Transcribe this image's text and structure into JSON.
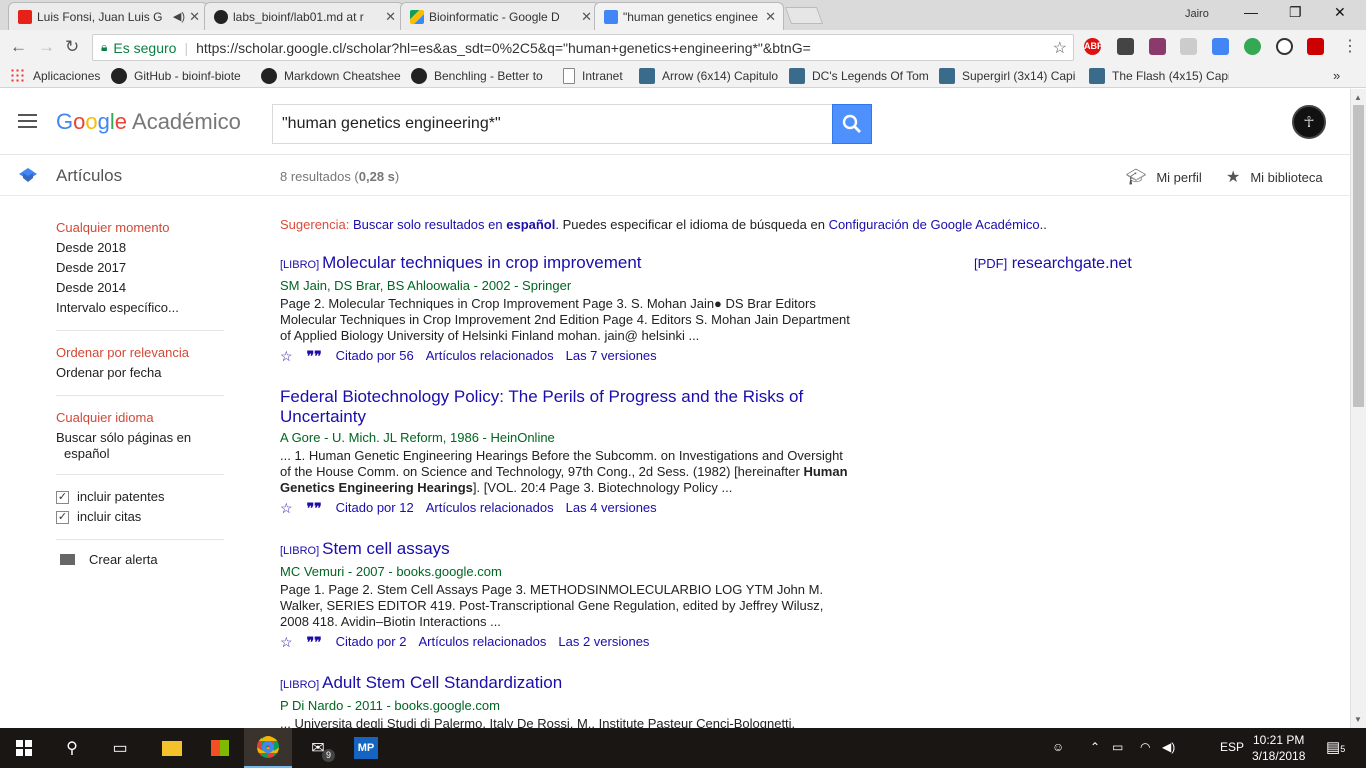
{
  "tabs": [
    {
      "title": "Luis Fonsi, Juan Luis G",
      "favicon": "youtube-icon",
      "color": "#e62117"
    },
    {
      "title": "labs_bioinf/lab01.md at r",
      "favicon": "github-icon",
      "color": "#222222"
    },
    {
      "title": "Bioinformatic - Google D",
      "favicon": "google-drive-icon",
      "color": "#fbbc05"
    },
    {
      "title": "\"human genetics enginee",
      "favicon": "google-scholar-icon",
      "color": "#4285f4"
    }
  ],
  "profile_name": "Jairo",
  "omnibox": {
    "secure_label": "Es seguro",
    "url": "https://scholar.google.cl/scholar?hl=es&as_sdt=0%2C5&q=\"human+genetics+engineering*\"&btnG="
  },
  "bookmarks": [
    {
      "label": "Aplicaciones",
      "icon": "apps-grid-icon"
    },
    {
      "label": "GitHub - bioinf-biote",
      "icon": "github-icon"
    },
    {
      "label": "Markdown Cheatshee",
      "icon": "github-icon"
    },
    {
      "label": "Benchling - Better to",
      "icon": "benchling-icon"
    },
    {
      "label": "Intranet",
      "icon": "page-icon"
    },
    {
      "label": "Arrow (6x14) Capitulo",
      "icon": "tv-icon"
    },
    {
      "label": "DC's Legends Of Tom",
      "icon": "tv-icon"
    },
    {
      "label": "Supergirl (3x14) Capi",
      "icon": "tv-icon"
    },
    {
      "label": "The Flash (4x15) Capi",
      "icon": "tv-icon"
    }
  ],
  "header": {
    "logo_google": "Google",
    "logo_suffix": "Académico",
    "search_value": "\"human genetics engineering*\"",
    "section": "Artículos",
    "count_prefix": "8 resultados (",
    "count_time": "0,28 s",
    "count_suffix": ")",
    "profile": "Mi perfil",
    "library": "Mi biblioteca"
  },
  "sidebar": {
    "time": [
      "Cualquier momento",
      "Desde 2018",
      "Desde 2017",
      "Desde 2014",
      "Intervalo específico..."
    ],
    "sort": [
      "Ordenar por relevancia",
      "Ordenar por fecha"
    ],
    "lang": [
      "Cualquier idioma",
      "Buscar sólo páginas en",
      "español"
    ],
    "checks": [
      "incluir patentes",
      "incluir citas"
    ],
    "alert": "Crear alerta"
  },
  "suggestion": {
    "label": "Sugerencia:",
    "link1": "Buscar solo resultados en",
    "link1_bold": "español",
    "mid": ". Puedes especificar el idioma de búsqueda en",
    "link2": "Configuración de Google Académico",
    "end": ".."
  },
  "pdf": {
    "tag": "[PDF]",
    "source": "researchgate.net"
  },
  "results": [
    {
      "tag": "[LIBRO]",
      "title": "Molecular techniques in crop improvement",
      "meta": "SM Jain, DS Brar, BS Ahloowalia - 2002 - Springer",
      "snippet": "Page 2. Molecular Techniques in Crop Improvement Page 3. S. Mohan Jain● DS Brar Editors Molecular Techniques in Crop Improvement 2nd Edition Page 4. Editors S. Mohan Jain Department of Applied Biology University of Helsinki Finland mohan. jain@ helsinki ...",
      "cited": "Citado por 56",
      "related": "Artículos relacionados",
      "versions": "Las 7 versiones"
    },
    {
      "tag": "",
      "title": "Federal Biotechnology Policy: The Perils of Progress and the Risks of Uncertainty",
      "meta": "A Gore - U. Mich. JL Reform, 1986 - HeinOnline",
      "snippet_pre": "... 1. Human Genetic Engineering Hearings Before the Subcomm. on Investigations and Oversight of the House Comm. on Science and Technology, 97th Cong., 2d Sess. (1982) [hereinafter ",
      "snippet_bold": "Human Genetics Engineering Hearings",
      "snippet_post": "]. [VOL. 20:4 Page 3. Biotechnology Policy ...",
      "cited": "Citado por 12",
      "related": "Artículos relacionados",
      "versions": "Las 4 versiones"
    },
    {
      "tag": "[LIBRO]",
      "title": "Stem cell assays",
      "meta": "MC Vemuri - 2007 - books.google.com",
      "snippet": "Page 1. Page 2. Stem Cell Assays Page 3. METHODSINMOLECULARBIO LOG YTM John M. Walker, SERIES EDITOR 419. Post-Transcriptional Gene Regulation, edited by Jeffrey Wilusz, 2008 418. Avidin–Biotin Interactions ...",
      "cited": "Citado por 2",
      "related": "Artículos relacionados",
      "versions": "Las 2 versiones"
    },
    {
      "tag": "[LIBRO]",
      "title": "Adult Stem Cell Standardization",
      "meta": "P Di Nardo - 2011 - books.google.com",
      "snippet": "... Universita degli Studi di Palermo, Italy De Rossi, M., Institute Pasteur Cenci-Bolognetti, DAHFMO-Unit of Histology and Medical Embryology, IIM, University ofRome “La Sapienza”, Rome,"
    }
  ],
  "taskbar": {
    "lang": "ESP",
    "time": "10:21 PM",
    "date": "3/18/2018",
    "mail_badge": "9",
    "notif_badge": "5"
  }
}
